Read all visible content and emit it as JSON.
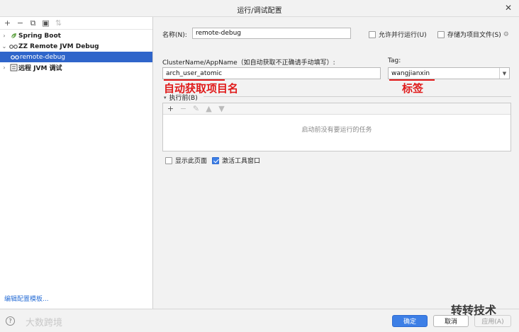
{
  "window": {
    "title": "运行/调试配置",
    "close_glyph": "✕"
  },
  "left": {
    "toolbar": [
      {
        "name": "add-icon",
        "glyph": "+"
      },
      {
        "name": "remove-icon",
        "glyph": "−"
      },
      {
        "name": "copy-icon",
        "glyph": "⧉"
      },
      {
        "name": "folder-icon",
        "glyph": "▣"
      },
      {
        "name": "sort-icon",
        "glyph": "⇅"
      }
    ],
    "tree": [
      {
        "label": "Spring Boot",
        "arrow": "›"
      },
      {
        "label": "ZZ Remote JVM Debug",
        "arrow": "⌄"
      },
      {
        "label": "remote-debug"
      },
      {
        "label": "远程 JVM 调试",
        "arrow": "›"
      }
    ],
    "edit_templates_link": "编辑配置模板..."
  },
  "form": {
    "name_label": "名称(N):",
    "name_value": "remote-debug",
    "allow_parallel": "允许并行运行(U)",
    "store_as_file": "存储为项目文件(S)",
    "cluster_label": "ClusterName/AppName（如自动获取不正确请手动填写）:",
    "cluster_value": "arch_user_atomic",
    "tag_label": "Tag:",
    "tag_value": "wangjianxin",
    "annot_auto": "自动获取项目名",
    "annot_tag": "标签",
    "before_launch": "执行前(B)",
    "before_empty": "启动前没有要运行的任务",
    "show_page": "显示此页面",
    "activate_tool": "激活工具窗口"
  },
  "buttons": {
    "ok": "确定",
    "cancel": "取消",
    "apply": "应用(A)"
  },
  "watermarks": {
    "left": "大数跨境",
    "right": "转转技术"
  },
  "colors": {
    "accent": "#3d7fe6",
    "selected": "#2f65ca",
    "annotation": "#e01a1a",
    "link": "#2a6fd6"
  }
}
